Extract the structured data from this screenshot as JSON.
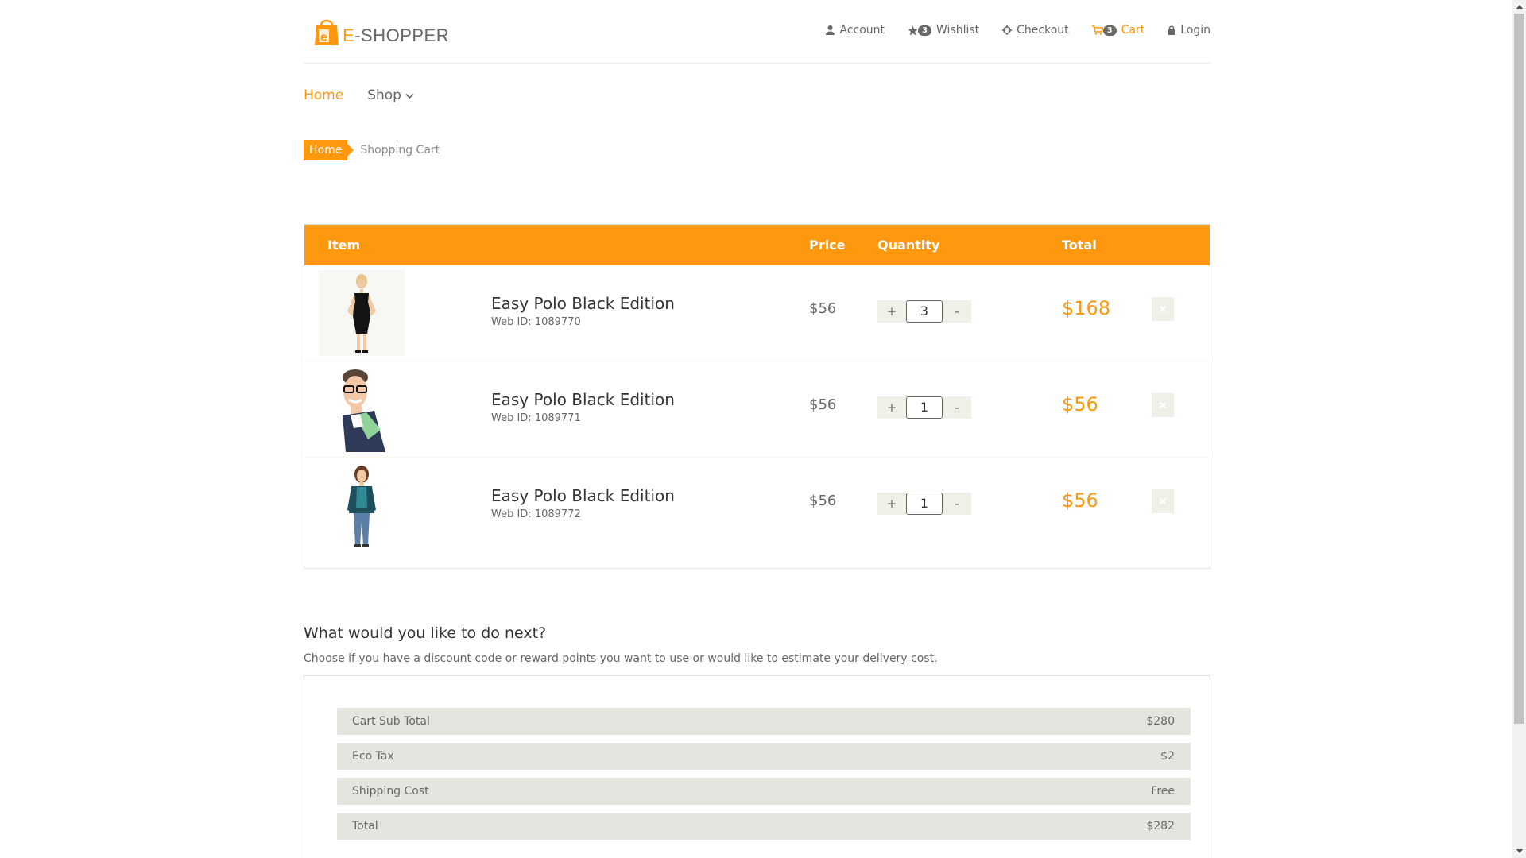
{
  "brand": {
    "prefix": "E",
    "name": "-SHOPPER",
    "accent": "#fe980f"
  },
  "topnav": [
    {
      "label": "Account",
      "icon": "user-icon"
    },
    {
      "label": "Wishlist",
      "icon": "star-icon",
      "badge": "3"
    },
    {
      "label": "Checkout",
      "icon": "crosshair-icon"
    },
    {
      "label": "Cart",
      "icon": "cart-icon",
      "badge": "3",
      "active": true
    },
    {
      "label": "Login",
      "icon": "lock-icon"
    }
  ],
  "mainnav": {
    "home": "Home",
    "shop": "Shop"
  },
  "breadcrumb": {
    "home": "Home",
    "current": "Shopping Cart"
  },
  "cart": {
    "headers": {
      "item": "Item",
      "price": "Price",
      "quantity": "Quantity",
      "total": "Total"
    },
    "qty_plus": "+",
    "qty_minus": "-",
    "items": [
      {
        "title": "Easy Polo Black Edition",
        "webid": "Web ID: 1089770",
        "price": "$56",
        "qty": "3",
        "total": "$168",
        "image": "woman-black-dress"
      },
      {
        "title": "Easy Polo Black Edition",
        "webid": "Web ID: 1089771",
        "price": "$56",
        "qty": "1",
        "total": "$56",
        "image": "man-glasses-sweater"
      },
      {
        "title": "Easy Polo Black Edition",
        "webid": "Web ID: 1089772",
        "price": "$56",
        "qty": "1",
        "total": "$56",
        "image": "woman-teal-cardigan"
      }
    ]
  },
  "next": {
    "title": "What would you like to do next?",
    "subtitle": "Choose if you have a discount code or reward points you want to use or would like to estimate your delivery cost."
  },
  "summary": [
    {
      "label": "Cart Sub Total",
      "value": "$280"
    },
    {
      "label": "Eco Tax",
      "value": "$2"
    },
    {
      "label": "Shipping Cost",
      "value": "Free"
    },
    {
      "label": "Total",
      "value": "$282"
    }
  ]
}
